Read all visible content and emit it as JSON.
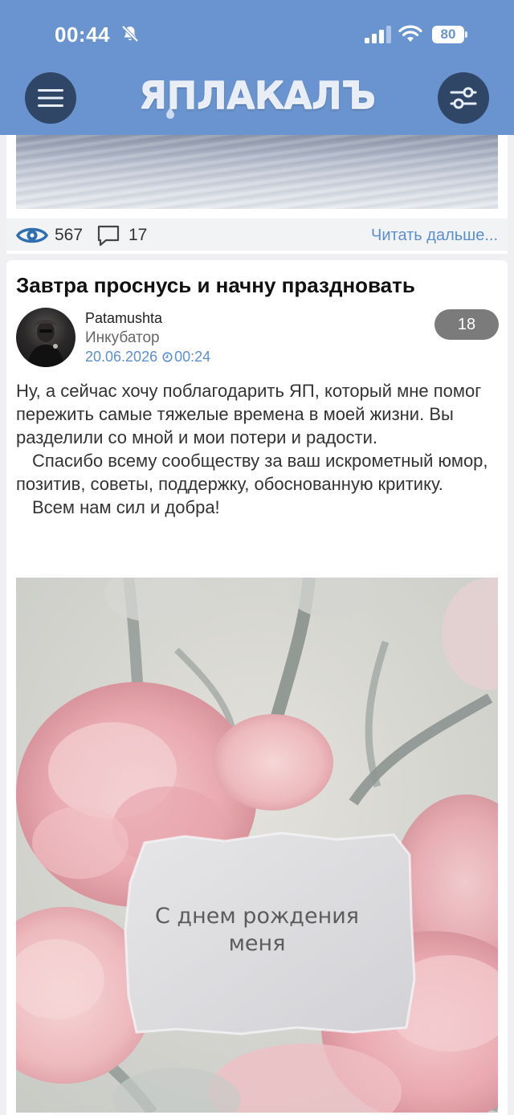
{
  "status_bar": {
    "time": "00:44",
    "battery": "80"
  },
  "header": {
    "logo": "ЯПЛАКАЛЪ",
    "menu_icon": "hamburger-icon",
    "filter_icon": "sliders-icon",
    "background_color": "#6a94cf",
    "button_color": "#2f4666"
  },
  "previous_post": {
    "views": "567",
    "comments": "17",
    "read_more": "Читать дальше..."
  },
  "post": {
    "title": "Завтра проснусь и начну праздновать",
    "author": "Patamushta",
    "rank": "Инкубатор",
    "date": "20.06.2026",
    "time": "00:24",
    "comment_count": "18",
    "paragraphs": [
      "Ну, а сейчас хочу поблагодарить ЯП, который мне помог пережить самые тяжелые времена в моей жизни. Вы разделили со мной и мои потери и радости.",
      "Спасибо всему сообществу за ваш искрометный юмор, позитив, советы, поддержку, обоснованную критику.",
      "Всем нам сил и добра!"
    ],
    "image_text_line1": "С днем рождения",
    "image_text_line2": "меня"
  },
  "colors": {
    "accent_link": "#5b8fd0",
    "badge": "#7b7b7b"
  }
}
